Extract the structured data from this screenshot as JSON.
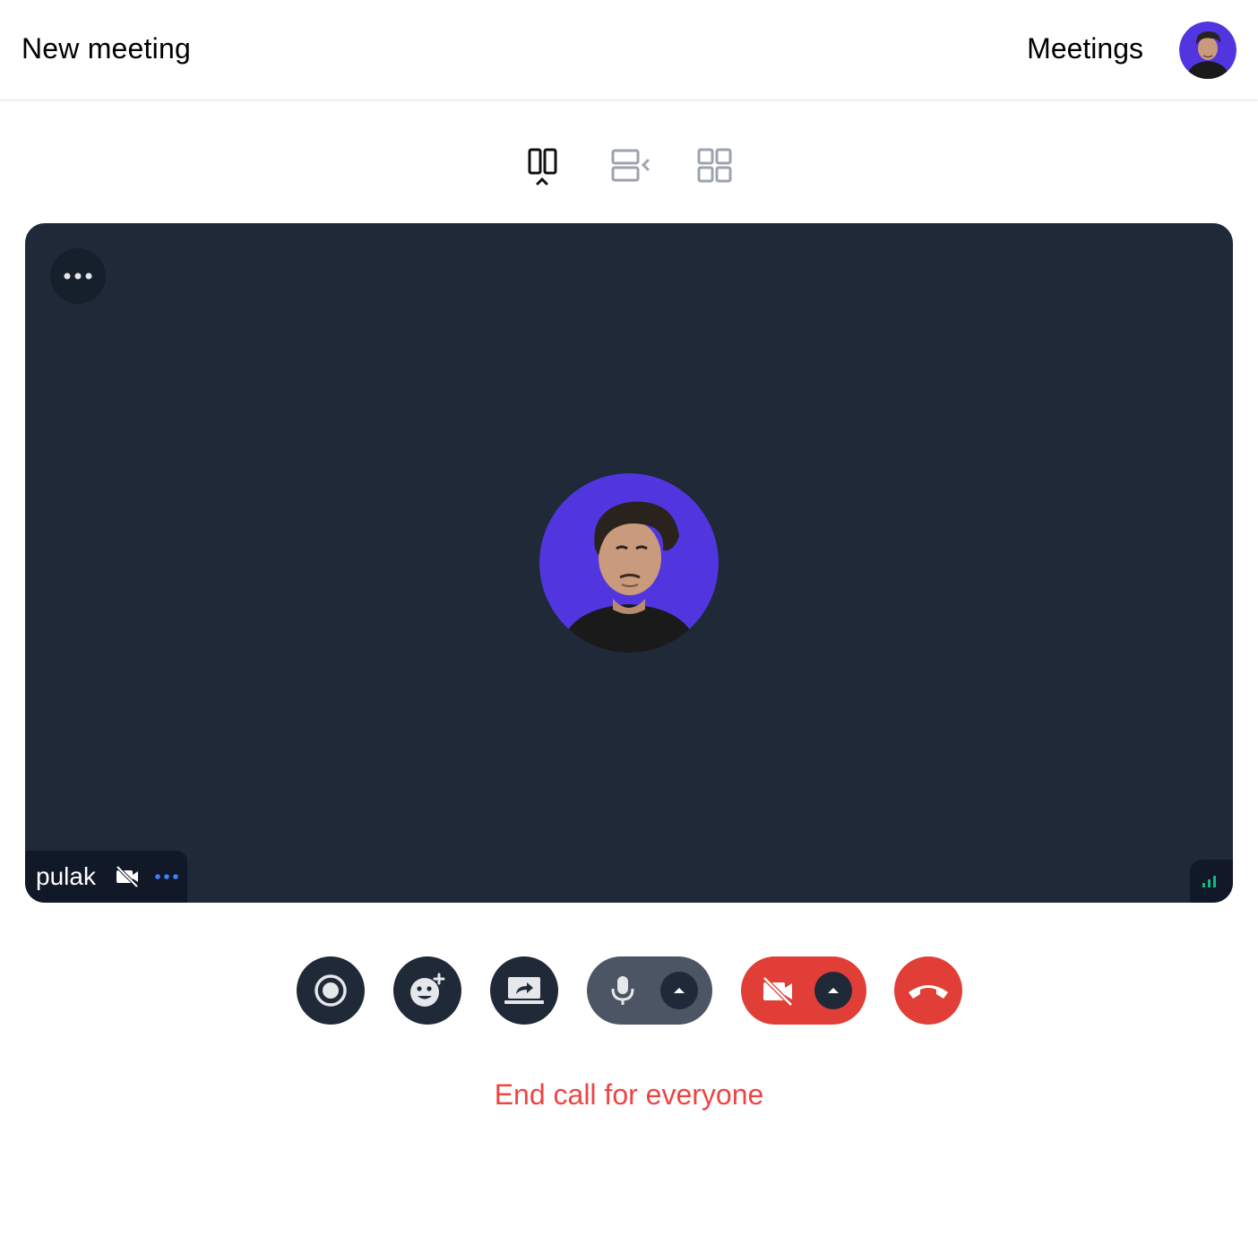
{
  "header": {
    "title": "New meeting",
    "meetings_label": "Meetings",
    "avatar_icon": "user-avatar"
  },
  "layout_switcher": {
    "options": [
      {
        "icon": "spotlight-layout-icon",
        "active": true
      },
      {
        "icon": "sidebar-layout-icon",
        "active": false
      },
      {
        "icon": "grid-layout-icon",
        "active": false
      }
    ]
  },
  "stage": {
    "participant": {
      "name": "pulak",
      "camera_icon": "camera-off-icon",
      "more_icon": "more-dots-icon"
    },
    "signal_icon": "signal-strength-icon",
    "menu_icon": "more-dots-icon"
  },
  "controls": [
    {
      "icon": "record-icon"
    },
    {
      "icon": "emoji-reaction-icon"
    },
    {
      "icon": "screen-share-icon"
    },
    {
      "icon": "microphone-icon",
      "secondary_icon": "chevron-up-icon"
    },
    {
      "icon": "camera-off-icon",
      "secondary_icon": "chevron-up-icon"
    },
    {
      "icon": "hang-up-icon"
    }
  ],
  "end_call_label": "End call for everyone",
  "colors": {
    "stage_bg": "#1f2937",
    "danger": "#e03e36",
    "end_text": "#ef4444",
    "avatar_bg": "#5136e0",
    "signal": "#10b981",
    "accent_dots": "#3b82f6"
  }
}
